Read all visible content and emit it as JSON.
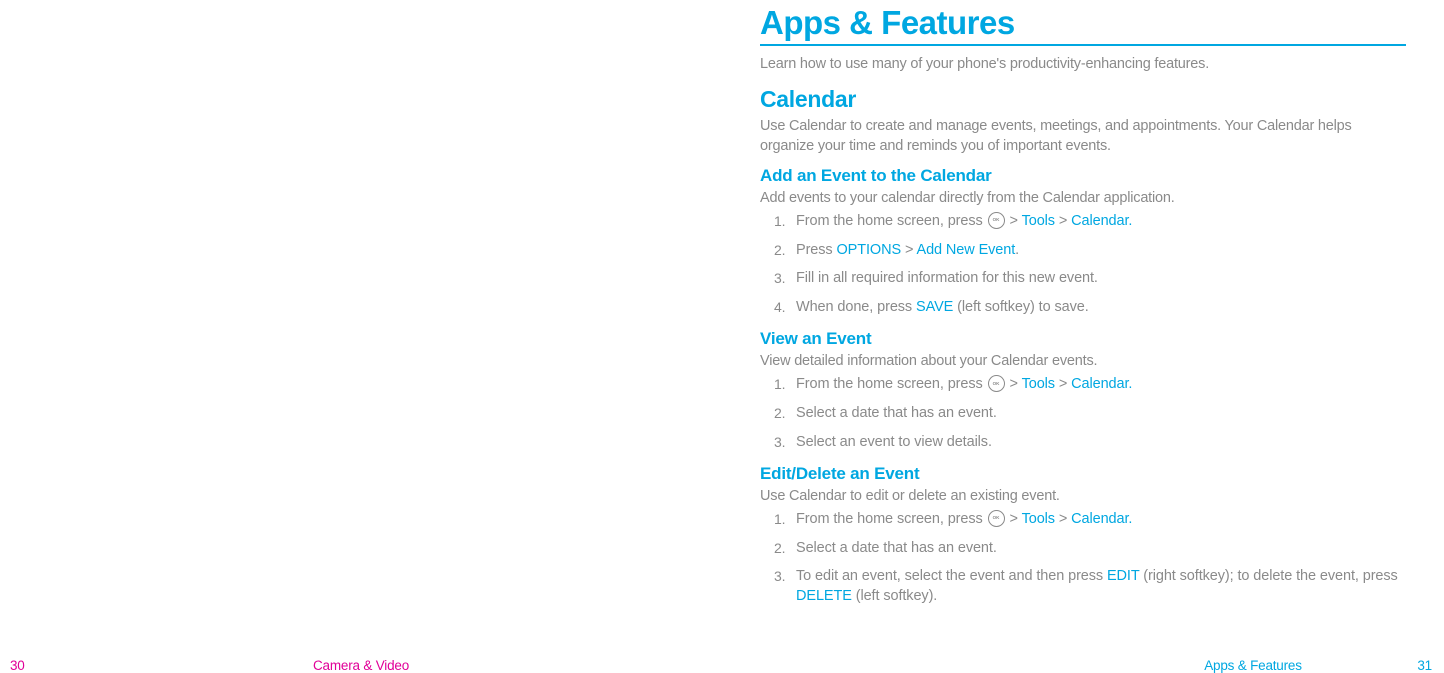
{
  "right": {
    "title": "Apps & Features",
    "intro": "Learn how to use many of your phone's productivity-enhancing features.",
    "calendar": {
      "heading": "Calendar",
      "desc": "Use Calendar to create and manage events, meetings, and appointments. Your Calendar helps organize your time and reminds you of important events.",
      "add": {
        "heading": "Add an Event to the Calendar",
        "desc": "Add events to your calendar directly from the Calendar application.",
        "s1a": "From the home screen, press ",
        "s1b": " > ",
        "s1_tools": "Tools",
        "s1c": " > ",
        "s1_cal": "Calendar.",
        "s2a": "Press ",
        "s2_options": "OPTIONS",
        "s2b": " > ",
        "s2_add": "Add New Event",
        "s2c": ".",
        "s3": "Fill in all required information for this new event.",
        "s4a": "When done, press ",
        "s4_save": "SAVE",
        "s4b": " (left softkey) to save."
      },
      "view": {
        "heading": "View an Event",
        "desc": "View detailed information about your Calendar events.",
        "s1a": "From the home screen, press ",
        "s1b": " > ",
        "s1_tools": "Tools",
        "s1c": " > ",
        "s1_cal": "Calendar.",
        "s2": "Select a date that has an event.",
        "s3": "Select an event to view details."
      },
      "edit": {
        "heading": "Edit/Delete an Event",
        "desc": "Use Calendar to edit or delete an existing event.",
        "s1a": "From the home screen, press ",
        "s1b": " > ",
        "s1_tools": "Tools",
        "s1c": " > ",
        "s1_cal": "Calendar.",
        "s2": "Select a date that has an event.",
        "s3a": "To edit an event, select the event and then press ",
        "s3_edit": "EDIT",
        "s3b": " (right softkey); to delete the event, press ",
        "s3_delete": "DELETE",
        "s3c": " (left softkey)."
      }
    }
  },
  "footer": {
    "left_page": "30",
    "left_section": "Camera & Video",
    "right_section": "Apps & Features",
    "right_page": "31"
  },
  "nums": {
    "n1": "1.",
    "n2": "2.",
    "n3": "3.",
    "n4": "4."
  }
}
